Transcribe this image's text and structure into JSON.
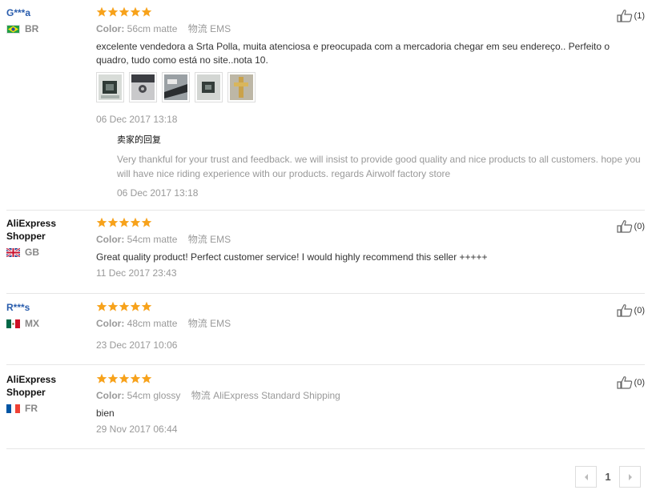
{
  "reviews": [
    {
      "user": "G***a",
      "user_style": "link",
      "country": "BR",
      "color_label": "Color:",
      "color_value": "56cm matte",
      "shipping_label": "物流",
      "shipping_value": "EMS",
      "text": "excelente vendedora a Srta Polla, muita atenciosa e preocupada com a mercadoria chegar em seu endereço.. Perfeito o quadro, tudo como está no site..nota 10.",
      "date": "06 Dec 2017 13:18",
      "likes": "(1)",
      "reply_title": "卖家的回复",
      "reply_text": "Very thankful for your trust and feedback. we will insist to provide good quality and nice products to all customers. hope you will have nice riding experience with our products. regards Airwolf factory store",
      "reply_date": "06 Dec 2017 13:18"
    },
    {
      "user": "AliExpress Shopper",
      "user_style": "plain",
      "country": "GB",
      "color_label": "Color:",
      "color_value": "54cm matte",
      "shipping_label": "物流",
      "shipping_value": "EMS",
      "text": "Great quality product! Perfect customer service! I would highly recommend this seller +++++",
      "date": "11 Dec 2017 23:43",
      "likes": "(0)"
    },
    {
      "user": "R***s",
      "user_style": "link",
      "country": "MX",
      "color_label": "Color:",
      "color_value": "48cm matte",
      "shipping_label": "物流",
      "shipping_value": "EMS",
      "text": "",
      "date": "23 Dec 2017 10:06",
      "likes": "(0)"
    },
    {
      "user": "AliExpress Shopper",
      "user_style": "plain",
      "country": "FR",
      "color_label": "Color:",
      "color_value": "54cm glossy",
      "shipping_label": "物流",
      "shipping_value": "AliExpress Standard Shipping",
      "text": "bien",
      "date": "29 Nov 2017 06:44",
      "likes": "(0)"
    }
  ],
  "rating": 5,
  "pagination": {
    "current": "1"
  },
  "colors": {
    "star": "#f7a21b",
    "link": "#2a5dad"
  }
}
